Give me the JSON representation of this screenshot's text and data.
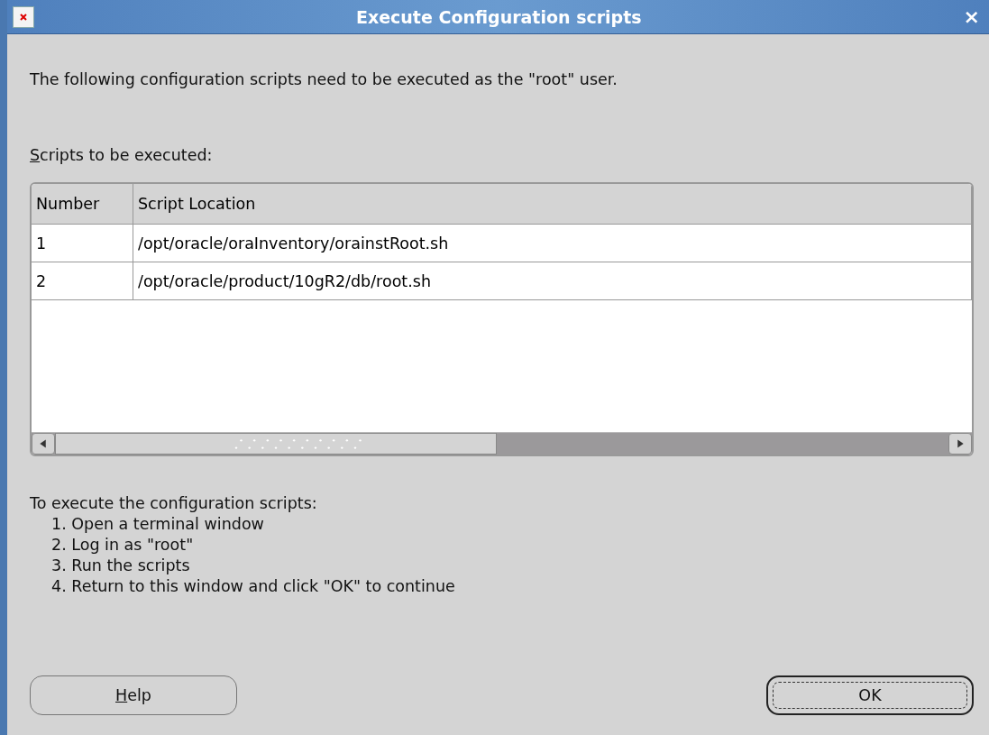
{
  "window": {
    "title": "Execute Configuration scripts",
    "close": "×"
  },
  "message": "The following configuration scripts need to be executed as the \"root\" user.",
  "table_label": "Scripts to be executed:",
  "table": {
    "columns": [
      "Number",
      "Script Location"
    ],
    "rows": [
      [
        "1",
        "/opt/oracle/oraInventory/orainstRoot.sh"
      ],
      [
        "2",
        "/opt/oracle/product/10gR2/db/root.sh"
      ]
    ]
  },
  "instructions": {
    "heading": "To execute the configuration scripts:",
    "steps": [
      "1. Open a terminal window",
      "2. Log in as \"root\"",
      "3. Run the scripts",
      "4. Return to this window and click \"OK\" to continue"
    ]
  },
  "buttons": [
    {
      "label": "Help",
      "focused": false
    },
    {
      "label": "OK",
      "focused": true
    }
  ]
}
